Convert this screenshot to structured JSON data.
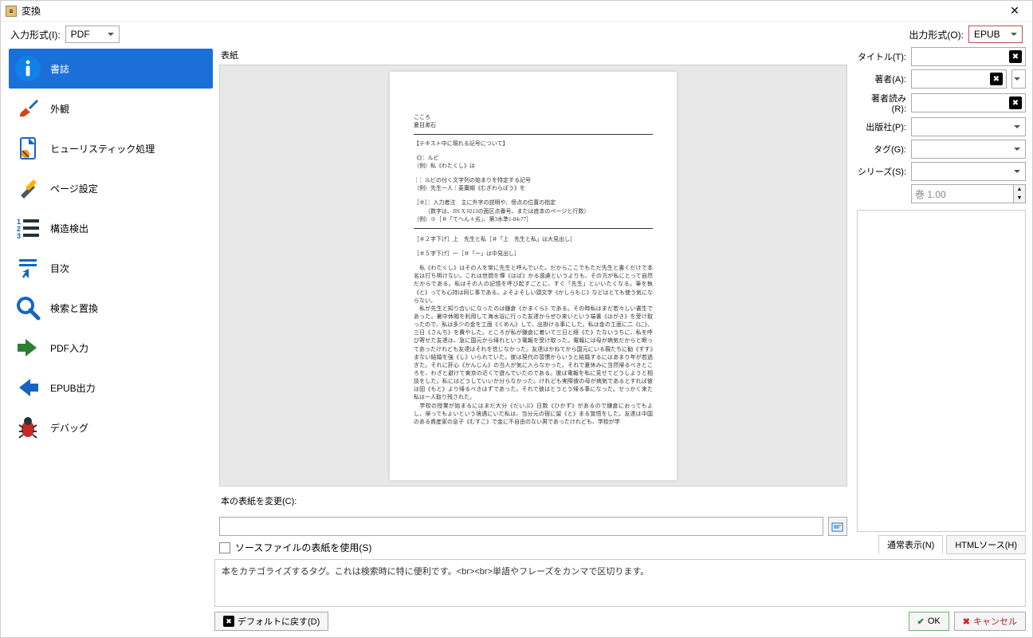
{
  "window": {
    "title": "変換"
  },
  "topbar": {
    "input_format_label": "入力形式(I):",
    "input_format_value": "PDF",
    "output_format_label": "出力形式(O):",
    "output_format_value": "EPUB"
  },
  "sidebar": {
    "items": [
      {
        "label": "書誌",
        "icon": "info-icon"
      },
      {
        "label": "外観",
        "icon": "brush-icon"
      },
      {
        "label": "ヒューリスティック処理",
        "icon": "page-magic-icon"
      },
      {
        "label": "ページ設定",
        "icon": "tools-icon"
      },
      {
        "label": "構造検出",
        "icon": "list-numbered-icon"
      },
      {
        "label": "目次",
        "icon": "hand-point-icon"
      },
      {
        "label": "検索と置換",
        "icon": "search-icon"
      },
      {
        "label": "PDF入力",
        "icon": "arrow-right-green-icon"
      },
      {
        "label": "EPUB出力",
        "icon": "arrow-left-blue-icon"
      },
      {
        "label": "デバッグ",
        "icon": "bug-icon"
      }
    ]
  },
  "center": {
    "cover_label": "表紙",
    "change_cover_label": "本の表紙を変更(C):",
    "use_source_cover_label": "ソースファイルの表紙を使用(S)"
  },
  "preview": {
    "title": "こころ",
    "author": "夏目漱石",
    "note_header": "【テキスト中に現れる記号について】",
    "ruby_sym": "《》：ルビ",
    "ruby_ex": "（例）私《わたくし》は",
    "pipe_head": "｜：ルビの付く文字列の始まりを特定する記号",
    "pipe_ex": "（例）先生一人｜麦藁帽《むぎわらぼう》を",
    "hash_head": "［＃］：入力者注　主に外字の説明や、傍点の位置の指定",
    "hash_note1": "（数字は、JIS X 0213の面区点番号、または底本のページと行数）",
    "hash_note2": "（例）※［＃「てへん＋劣」、第3水準1-84-77］",
    "big_head": "［＃２字下げ］上　先生と私［＃「上　先生と私」は大見出し］",
    "mid_head": "［＃５字下げ］一［＃「一」は中見出し］",
    "para1": "　私《わたくし》はその人を常に先生と呼んでいた。だからここでもただ先生と書くだけで本名は打ち明けない。これは世間を憚《はば》かる遠慮というよりも、その方が私にとって自然だからである。私はその人の記憶を呼び起すごとに、すぐ「先生」といいたくなる。筆を執《と》っても心持は同じ事である。よそよそしい頭文字《かしらもじ》などはとても使う気にならない。",
    "para2": "　私が先生と知り合いになったのは鎌倉《かまくら》である。その時私はまだ若々しい書生であった。暑中休暇を利用して海水浴に行った友達からぜひ来いという端書《はがき》を受け取ったので、私は多少の金を工面《くめん》して、出掛ける事にした。私は金の工面に二《に》、三日《さんち》を費やした。ところが私が鎌倉に着いて三日と経《た》たないうちに、私を呼び寄せた友達は、急に国元から帰れという電報を受け取った。電報には母が病気だからと断ってあったけれども友達はそれを信じなかった。友達はかねてから国元にいる親たちに勧《すす》まない結婚を強《し》いられていた。彼は現代の習慣からいうと結婚するにはあまり年が若過ぎた。それに肝心《かんじん》の当人が気に入らなかった。それで夏休みに当然帰るべきところを、わざと避けて東京の近くで遊んでいたのである。彼は電報を私に見せてどうしようと相談をした。私にはどうしていいか分らなかった。けれども実際彼の母が病気であるとすれば彼は固《もと》より帰るべきはずであった。それで彼はとうとう帰る事になった。せっかく来た私は一人取り残された。",
    "para3": "　学校の授業が始まるにはまだ大分《だいぶ》日数《ひかず》があるので鎌倉におってもよし、帰ってもよいという境遇にいた私は、当分元の宿に留《と》まる覚悟をした。友達は中国のある資産家の息子《むすこ》で金に不自由のない男であったけれども、学校が学"
  },
  "form": {
    "title_label": "タイトル(T):",
    "author_label": "著者(A):",
    "author_sort_label": "著者読み(R):",
    "publisher_label": "出版社(P):",
    "tags_label": "タグ(G):",
    "series_label": "シリーズ(S):",
    "series_index_label": "巻",
    "series_index_value": "巻 1.00"
  },
  "viewtabs": {
    "normal": "通常表示(N)",
    "html": "HTMLソース(H)"
  },
  "hint": "本をカテゴライズするタグ。これは検索時に特に便利です。<br><br>単語やフレーズをカンマで区切ります。",
  "footer": {
    "restore_label": "デフォルトに戻す(D)",
    "ok_label": "OK",
    "cancel_label": "キャンセル"
  }
}
